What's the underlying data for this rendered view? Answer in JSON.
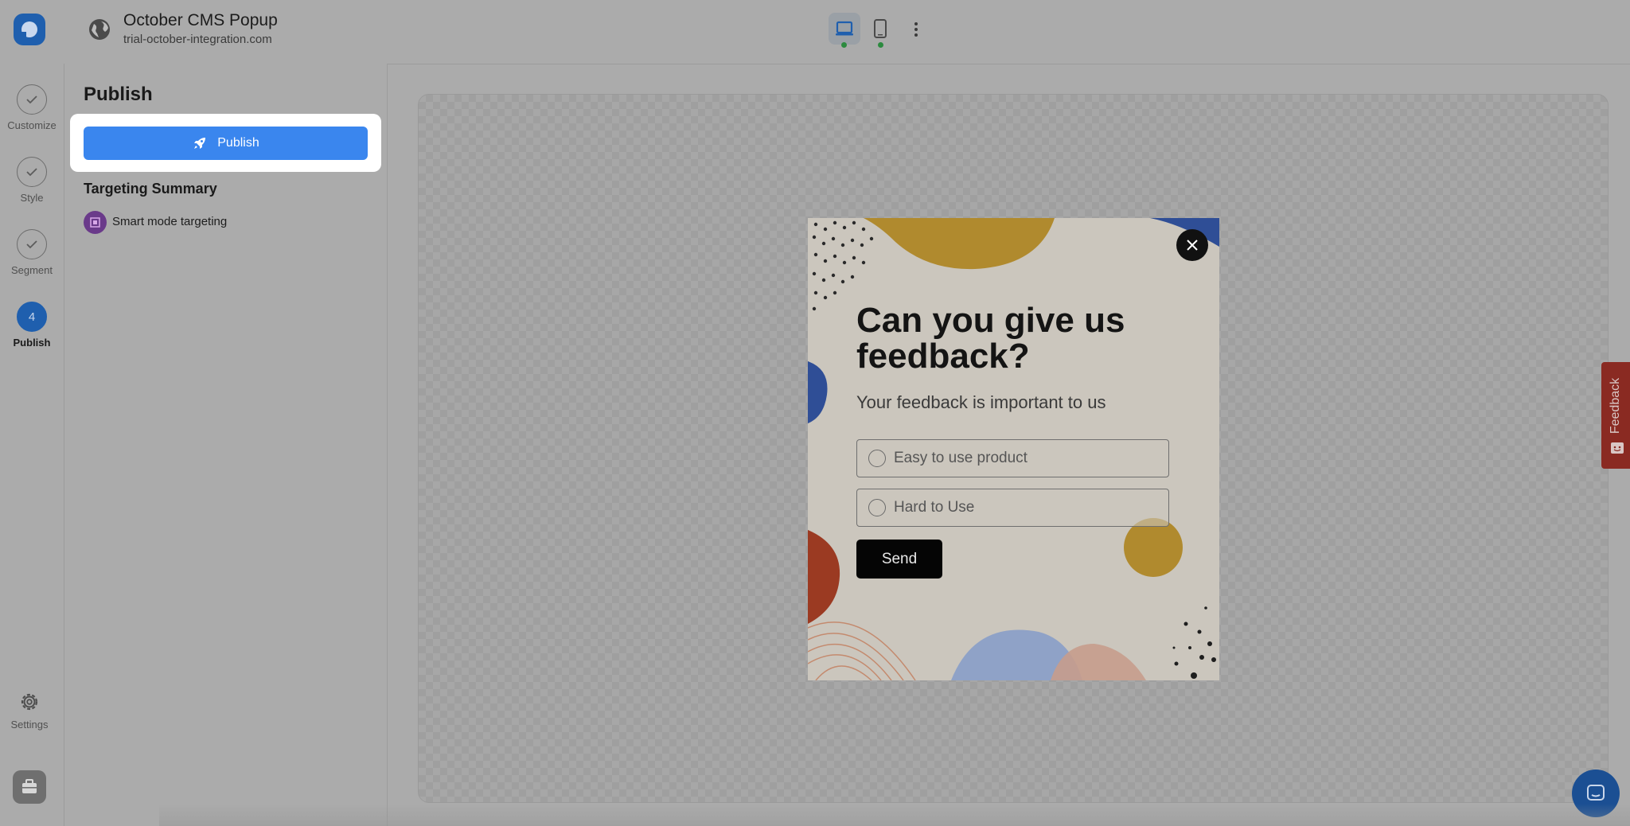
{
  "header": {
    "title": "October CMS Popup",
    "domain": "trial-october-integration.com"
  },
  "rail": {
    "steps": [
      {
        "label": "Customize",
        "state": "done"
      },
      {
        "label": "Style",
        "state": "done"
      },
      {
        "label": "Segment",
        "state": "done"
      },
      {
        "label": "Publish",
        "state": "active",
        "number": "4"
      }
    ],
    "settings_label": "Settings"
  },
  "panel": {
    "title": "Publish",
    "publish_button": "Publish",
    "targeting_title": "Targeting Summary",
    "targeting_item": "Smart mode targeting"
  },
  "popup": {
    "title": "Can you give us feedback?",
    "subtitle": "Your feedback is important to us",
    "options": [
      "Easy to use product",
      "Hard to Use"
    ],
    "send_label": "Send"
  },
  "feedback_tab": "Feedback",
  "colors": {
    "accent": "#3a86ee",
    "brand": "#1f5fae",
    "popup_bg": "#cbc6bd"
  }
}
